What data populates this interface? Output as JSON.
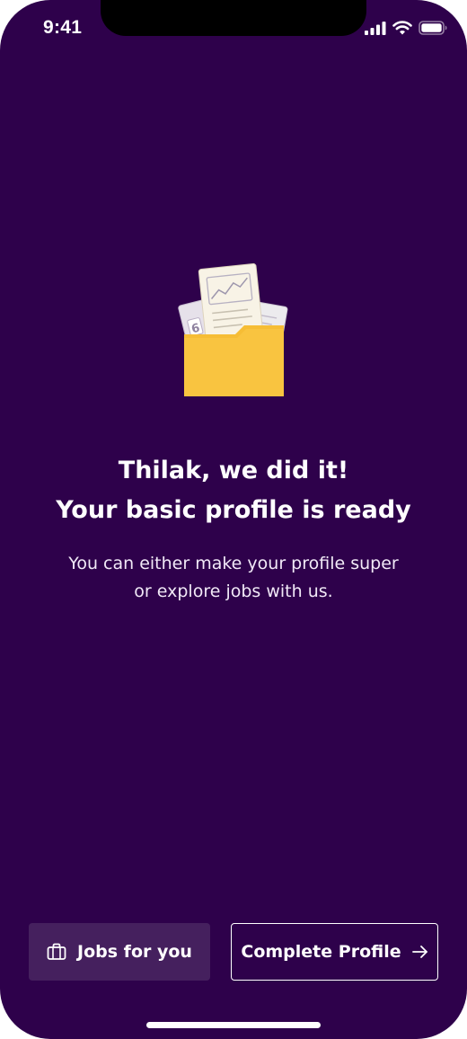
{
  "status_bar": {
    "time": "9:41",
    "icons": [
      "cellular-signal-icon",
      "wifi-icon",
      "battery-icon"
    ]
  },
  "illustration": {
    "icon": "folder-with-documents-icon",
    "document_digit": "6"
  },
  "content": {
    "title_line1": "Thilak, we did it!",
    "title_line2": "Your basic profile is ready",
    "subtitle_line1": "You can either make your profile super",
    "subtitle_line2": "or explore jobs with us."
  },
  "actions": {
    "jobs_button": {
      "label": "Jobs for you",
      "icon": "briefcase-icon"
    },
    "complete_button": {
      "label": "Complete Profile",
      "icon": "arrow-right-icon"
    }
  },
  "colors": {
    "background": "#2e014b",
    "jobs_button_bg": "#45205e",
    "folder": "#f9c440",
    "text": "#ffffff"
  }
}
